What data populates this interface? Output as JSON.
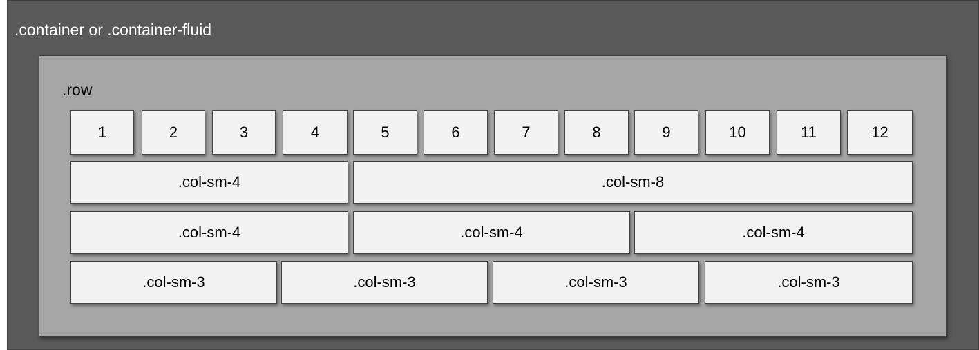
{
  "container": {
    "label": ".container or .container-fluid"
  },
  "row": {
    "label": ".row"
  },
  "grid_numbers": [
    "1",
    "2",
    "3",
    "4",
    "5",
    "6",
    "7",
    "8",
    "9",
    "10",
    "11",
    "12"
  ],
  "layout_rows": [
    [
      ".col-sm-4",
      ".col-sm-8"
    ],
    [
      ".col-sm-4",
      ".col-sm-4",
      ".col-sm-4"
    ],
    [
      ".col-sm-3",
      ".col-sm-3",
      ".col-sm-3",
      ".col-sm-3"
    ]
  ],
  "colors": {
    "container_bg": "#595959",
    "row_bg": "#a6a6a6",
    "cell_bg": "#f2f2f2"
  }
}
